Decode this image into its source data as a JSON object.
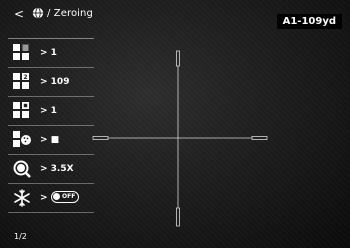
{
  "header": {
    "back_icon": "chevron-left",
    "globe_icon": "globe",
    "title": "/ Zeroing",
    "profile": "A1-109yd"
  },
  "menu": {
    "items": [
      {
        "icon": "grid-icon-1",
        "value": "> 1"
      },
      {
        "icon": "grid-icon-2",
        "value": "> 109"
      },
      {
        "icon": "grid-icon-3",
        "value": "> 1"
      },
      {
        "icon": "reticle-color-icon",
        "value": "> ■"
      },
      {
        "icon": "zoom-icon",
        "value": "> 3.5X"
      },
      {
        "icon": "freeze-icon",
        "value": ">",
        "toggle": "OFF"
      }
    ]
  },
  "footer": {
    "page": "1/2"
  },
  "colors": {
    "background": "#1e1e1e",
    "text": "#ffffff",
    "profile_bg": "#000000"
  }
}
